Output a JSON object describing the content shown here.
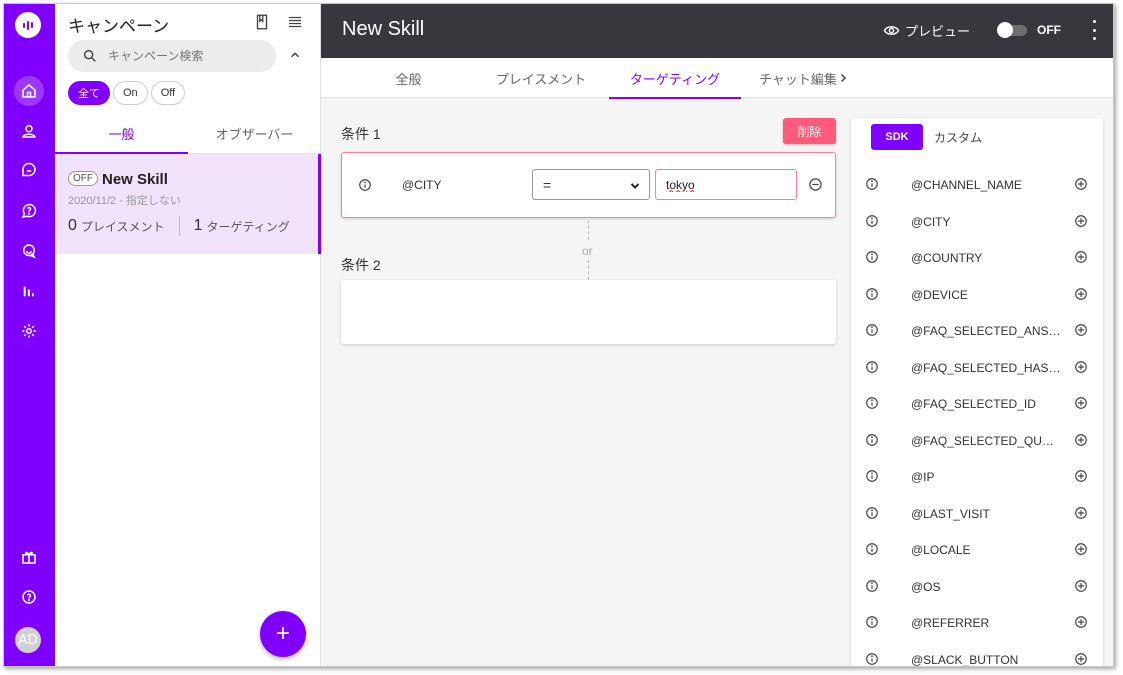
{
  "rail": {
    "avatar_initials": "AD",
    "accent": "#8000ff",
    "icons": [
      "home-icon",
      "user-icon",
      "chat-icon",
      "help-chat-icon",
      "message-icon",
      "analytics-icon",
      "settings-icon",
      "gift-icon",
      "help-icon"
    ]
  },
  "campaigns": {
    "title": "キャンペーン",
    "search_placeholder": "キャンペーン検索",
    "filters": [
      "全て",
      "On",
      "Off"
    ],
    "tabs": [
      "一般",
      "オブザーバー"
    ],
    "items": [
      {
        "status": "OFF",
        "name": "New Skill",
        "date": "2020/11/2 - 指定しない",
        "placements_count": "0",
        "placements_label": "プレイスメント",
        "targeting_count": "1",
        "targeting_label": "ターゲティング"
      }
    ],
    "fab_label": "+"
  },
  "header": {
    "title": "New Skill",
    "preview_label": "プレビュー",
    "toggle_state": "OFF"
  },
  "tabs": [
    "全般",
    "プレイスメント",
    "ターゲティング",
    "チャット編集"
  ],
  "active_tab": "ターゲティング",
  "conditions": {
    "cond1_label": "条件 1",
    "delete_label": "削除",
    "variable": "@CITY",
    "operator": "=",
    "value": "tokyo",
    "or_label": "or",
    "cond2_label": "条件 2"
  },
  "variables_panel": {
    "sdk_label": "SDK",
    "custom_label": "カスタム",
    "items": [
      "@CHANNEL_NAME",
      "@CITY",
      "@COUNTRY",
      "@DEVICE",
      "@FAQ_SELECTED_ANSW...",
      "@FAQ_SELECTED_HASHT...",
      "@FAQ_SELECTED_ID",
      "@FAQ_SELECTED_QUEST...",
      "@IP",
      "@LAST_VISIT",
      "@LOCALE",
      "@OS",
      "@REFERRER",
      "@SLACK_BUTTON"
    ]
  }
}
